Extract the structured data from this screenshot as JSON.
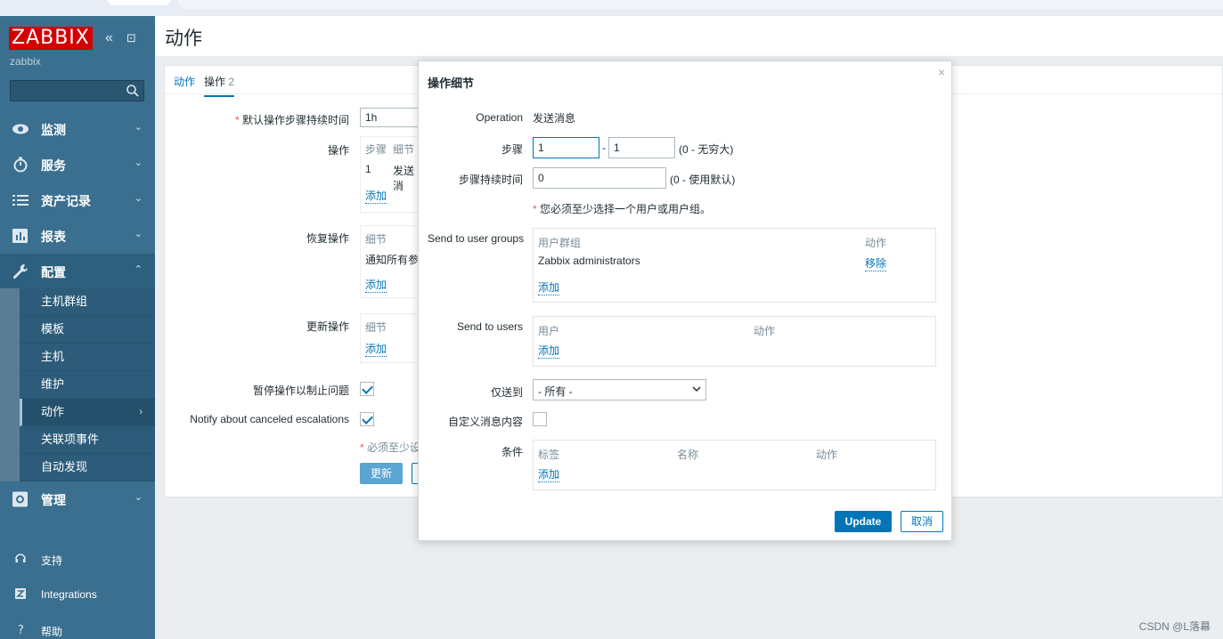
{
  "sidebar": {
    "logo": "ZABBIX",
    "server_name": "zabbix",
    "nav": [
      {
        "label": "监测",
        "icon": "eye-icon"
      },
      {
        "label": "服务",
        "icon": "stopwatch-icon"
      },
      {
        "label": "资产记录",
        "icon": "list-icon"
      },
      {
        "label": "报表",
        "icon": "bar-chart-icon"
      },
      {
        "label": "配置",
        "icon": "wrench-icon"
      },
      {
        "label": "管理",
        "icon": "gear-icon"
      }
    ],
    "subnav": [
      "主机群组",
      "模板",
      "主机",
      "维护",
      "动作",
      "关联项事件",
      "自动发现"
    ],
    "bottom": [
      {
        "label": "支持",
        "icon": "headset-icon"
      },
      {
        "label": "Integrations",
        "icon": "integrations-icon"
      },
      {
        "label": "帮助",
        "icon": "help-icon"
      }
    ]
  },
  "page": {
    "title": "动作",
    "tabs": {
      "action": "动作",
      "operations": "操作",
      "operations_count": "2"
    },
    "form": {
      "default_duration_label": "默认操作步骤持续时间",
      "default_duration_value": "1h",
      "operations_label": "操作",
      "op_col_steps": "步骤",
      "op_col_details": "细节",
      "op_row_step": "1",
      "op_row_detail": "发送消",
      "add": "添加",
      "recovery_label": "恢复操作",
      "recovery_col_details": "细节",
      "recovery_row": "通知所有参",
      "update_label": "更新操作",
      "update_col_details": "细节",
      "pause_label": "暂停操作以制止问题",
      "notify_label": "Notify about canceled escalations",
      "must_note": "必须至少设",
      "update_button": "更新"
    }
  },
  "modal": {
    "title": "操作细节",
    "operation_label": "Operation",
    "operation_value": "发送消息",
    "steps_label": "步骤",
    "steps_from": "1",
    "steps_dash": "-",
    "steps_to": "1",
    "steps_hint": "(0 - 无穷大)",
    "step_duration_label": "步骤持续时间",
    "step_duration_value": "0",
    "step_duration_hint": "(0 - 使用默认)",
    "required_note": "您必须至少选择一个用户或用户组。",
    "user_groups_label": "Send to user groups",
    "ug_col_group": "用户群组",
    "ug_col_action": "动作",
    "ug_row_name": "Zabbix administrators",
    "ug_row_remove": "移除",
    "add": "添加",
    "users_label": "Send to users",
    "u_col_user": "用户",
    "u_col_action": "动作",
    "send_only_label": "仅送到",
    "send_only_value": "- 所有 -",
    "custom_message_label": "自定义消息内容",
    "conditions_label": "条件",
    "c_col_label": "标签",
    "c_col_name": "名称",
    "c_col_action": "动作",
    "update_button": "Update",
    "cancel_button": "取消"
  },
  "watermark": "CSDN @L落幕"
}
